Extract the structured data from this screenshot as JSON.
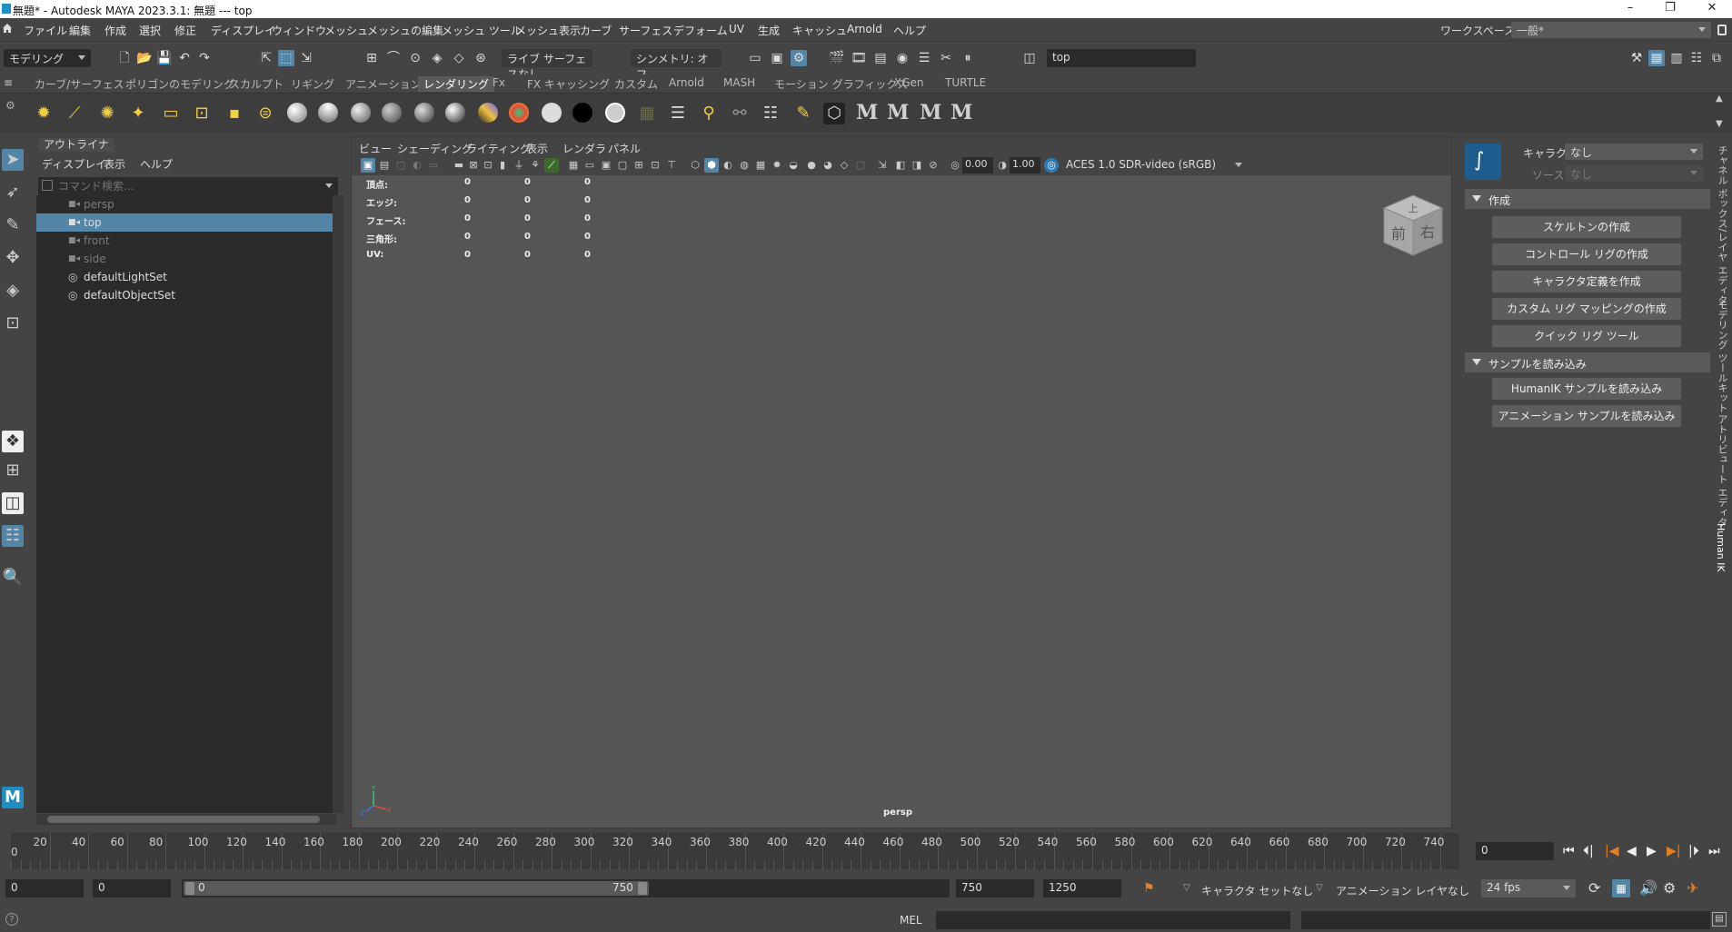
{
  "window": {
    "title": "無題* - Autodesk MAYA 2023.3.1: 無題   ---   top"
  },
  "menu": [
    "ファイル",
    "編集",
    "作成",
    "選択",
    "修正",
    "ディスプレイ",
    "ウィンドウ",
    "メッシュ",
    "メッシュの編集",
    "メッシュ ツール",
    "メッシュ表示",
    "カーブ",
    "サーフェス",
    "デフォーム",
    "UV",
    "生成",
    "キャッシュ",
    "Arnold",
    "ヘルプ"
  ],
  "workspace": {
    "label": "ワークスペース:",
    "value": "一般*"
  },
  "status": {
    "mode": "モデリング",
    "live_surface": "ライブ サーフェスなし",
    "symmetry": "シンメトリ: オフ",
    "panel_field": "top"
  },
  "shelf_tabs": [
    "カーブ/サーフェス",
    "ポリゴンのモデリング",
    "スカルプト",
    "リギング",
    "アニメーション",
    "レンダリング",
    "Fx",
    "FX キャッシング",
    "カスタム",
    "Arnold",
    "MASH",
    "モーション グラフィックス",
    "XGen",
    "TURTLE"
  ],
  "shelf_active": "レンダリング",
  "outliner": {
    "title": "アウトライナ",
    "menu": [
      "ディスプレイ",
      "表示",
      "ヘルプ"
    ],
    "search_placeholder": "コマンド検索...",
    "items": [
      {
        "label": "persp",
        "icon": "camera-icon"
      },
      {
        "label": "top",
        "icon": "camera-icon"
      },
      {
        "label": "front",
        "icon": "camera-icon"
      },
      {
        "label": "side",
        "icon": "camera-icon"
      },
      {
        "label": "defaultLightSet",
        "icon": "set-icon"
      },
      {
        "label": "defaultObjectSet",
        "icon": "set-icon"
      }
    ]
  },
  "viewport": {
    "menu": [
      "ビュー",
      "シェーディング",
      "ライティング",
      "表示",
      "レンダラ",
      "パネル"
    ],
    "exposure": "0.00",
    "gamma": "1.00",
    "colorspace": "ACES 1.0 SDR-video (sRGB)",
    "hud": [
      {
        "label": "頂点:",
        "values": [
          "0",
          "0",
          "0"
        ]
      },
      {
        "label": "エッジ:",
        "values": [
          "0",
          "0",
          "0"
        ]
      },
      {
        "label": "フェース:",
        "values": [
          "0",
          "0",
          "0"
        ]
      },
      {
        "label": "三角形:",
        "values": [
          "0",
          "0",
          "0"
        ]
      },
      {
        "label": "UV:",
        "values": [
          "0",
          "0",
          "0"
        ]
      }
    ],
    "camera_label": "persp",
    "viewcube": {
      "top": "上",
      "front": "前",
      "right": "右"
    },
    "axis": {
      "y": "Y",
      "x": "X",
      "z": "Z"
    }
  },
  "humanik": {
    "character_label": "キャラクタ:",
    "character_value": "なし",
    "source_label": "ソース:",
    "source_value": "なし",
    "create_section": "作成",
    "create_buttons": [
      "スケルトンの作成",
      "コントロール リグの作成",
      "キャラクタ定義を作成",
      "カスタム リグ マッピングの作成",
      "クイック リグ ツール"
    ],
    "samples_section": "サンプルを読み込み",
    "sample_buttons": [
      "HumanIK サンプルを読み込み",
      "アニメーション サンプルを読み込み"
    ]
  },
  "side_tabs": [
    "チャネル ボックス/レイヤ エディタ",
    "モデリング ツールキット",
    "アトリビュート エディタ",
    "Human IK"
  ],
  "timeline": {
    "ticks": [
      "20",
      "40",
      "60",
      "80",
      "100",
      "120",
      "140",
      "160",
      "180",
      "200",
      "220",
      "240",
      "260",
      "280",
      "300",
      "320",
      "340",
      "360",
      "380",
      "400",
      "420",
      "440",
      "460",
      "480",
      "500",
      "520",
      "540",
      "560",
      "580",
      "600",
      "620",
      "640",
      "660",
      "680",
      "700",
      "720",
      "740"
    ],
    "current_frame_marker": "0",
    "current_frame": "0"
  },
  "range": {
    "start": "0",
    "anim_start": "0",
    "slider_start": "0",
    "slider_end": "750",
    "anim_end": "750",
    "end": "1250",
    "character_set": "キャラクタ セットなし",
    "anim_layer": "アニメーション レイヤなし",
    "fps": "24 fps"
  },
  "cmdline": {
    "mode": "MEL"
  }
}
